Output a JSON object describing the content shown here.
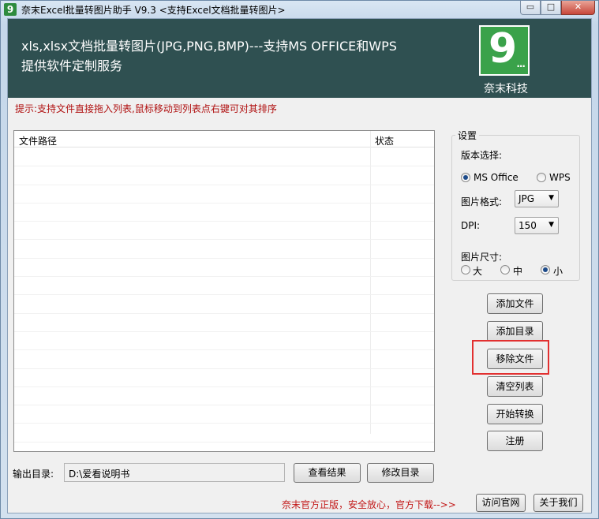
{
  "window": {
    "title": "奈末Excel批量转图片助手 V9.3 <支持Excel文档批量转图片>",
    "app_icon_glyph": "9",
    "minimize_glyph": "▭",
    "maximize_glyph": "□",
    "close_glyph": "✕"
  },
  "banner": {
    "line1": "xls,xlsx文档批量转图片(JPG,PNG,BMP)---支持MS OFFICE和WPS",
    "line2": "提供软件定制服务",
    "logo_main": "9",
    "logo_dots": "...",
    "logo_caption": "奈末科技",
    "bg_color": "#2f5051",
    "logo_color": "#3aa24a"
  },
  "hint": "提示:支持文件直接拖入列表,鼠标移动到列表点右键可对其排序",
  "file_list": {
    "columns": [
      "文件路径",
      "状态"
    ],
    "rows": []
  },
  "settings": {
    "legend": "设置",
    "version_label": "版本选择:",
    "version_options": [
      "MS Office",
      "WPS"
    ],
    "version_selected": "MS Office",
    "format_label": "图片格式:",
    "format_value": "JPG",
    "dpi_label": "DPI:",
    "dpi_value": "150",
    "size_label": "图片尺寸:",
    "size_options": [
      "大",
      "中",
      "小"
    ],
    "size_selected": "小"
  },
  "actions": {
    "add_file": "添加文件",
    "add_dir": "添加目录",
    "remove_file": "移除文件",
    "clear_list": "清空列表",
    "start": "开始转换",
    "register": "注册"
  },
  "output": {
    "label": "输出目录:",
    "value": "D:\\爱看说明书",
    "view_result": "查看结果",
    "change_dir": "修改目录"
  },
  "footer": {
    "text": "奈末官方正版，安全放心，官方下载-->>",
    "visit_site": "访问官网",
    "about": "关于我们"
  },
  "accent_color": "#e23030",
  "hint_color": "#b01010"
}
